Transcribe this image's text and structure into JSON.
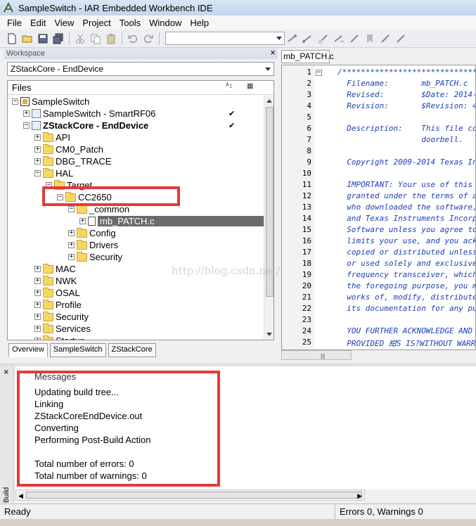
{
  "window": {
    "title": "SampleSwitch - IAR Embedded Workbench IDE"
  },
  "menu": [
    "File",
    "Edit",
    "View",
    "Project",
    "Tools",
    "Window",
    "Help"
  ],
  "workspace": {
    "header": "Workspace",
    "config": "ZStackCore - EndDevice",
    "files_header": "Files",
    "tree": [
      {
        "label": "SampleSwitch",
        "depth": 0,
        "kind": "workspace",
        "expander": "−"
      },
      {
        "label": "SampleSwitch - SmartRF06",
        "depth": 1,
        "kind": "project",
        "expander": "+",
        "check": "✔"
      },
      {
        "label": "ZStackCore - EndDevice",
        "depth": 1,
        "kind": "project",
        "expander": "−",
        "check": "✔",
        "bold": true
      },
      {
        "label": "API",
        "depth": 2,
        "kind": "folder",
        "expander": "+"
      },
      {
        "label": "CM0_Patch",
        "depth": 2,
        "kind": "folder",
        "expander": "+"
      },
      {
        "label": "DBG_TRACE",
        "depth": 2,
        "kind": "folder",
        "expander": "+"
      },
      {
        "label": "HAL",
        "depth": 2,
        "kind": "folder",
        "expander": "−"
      },
      {
        "label": "Target",
        "depth": 3,
        "kind": "folder",
        "expander": "−"
      },
      {
        "label": "CC2650",
        "depth": 4,
        "kind": "folder",
        "expander": "−"
      },
      {
        "label": "_common",
        "depth": 5,
        "kind": "folder",
        "expander": "−"
      },
      {
        "label": "mb_PATCH.c",
        "depth": 6,
        "kind": "file",
        "expander": "+",
        "selected": true
      },
      {
        "label": "Config",
        "depth": 5,
        "kind": "folder",
        "expander": "+"
      },
      {
        "label": "Drivers",
        "depth": 5,
        "kind": "folder",
        "expander": "+"
      },
      {
        "label": "Security",
        "depth": 5,
        "kind": "folder",
        "expander": "+"
      },
      {
        "label": "MAC",
        "depth": 2,
        "kind": "folder",
        "expander": "+"
      },
      {
        "label": "NWK",
        "depth": 2,
        "kind": "folder",
        "expander": "+"
      },
      {
        "label": "OSAL",
        "depth": 2,
        "kind": "folder",
        "expander": "+"
      },
      {
        "label": "Profile",
        "depth": 2,
        "kind": "folder",
        "expander": "+"
      },
      {
        "label": "Security",
        "depth": 2,
        "kind": "folder",
        "expander": "+"
      },
      {
        "label": "Services",
        "depth": 2,
        "kind": "folder",
        "expander": "+"
      },
      {
        "label": "Startup",
        "depth": 2,
        "kind": "folder",
        "expander": "+"
      }
    ],
    "tabs": [
      "Overview",
      "SampleSwitch",
      "ZStackCore"
    ]
  },
  "editor": {
    "tab": "mb_PATCH.c",
    "lines": [
      {
        "n": "1",
        "t": "/*********************************"
      },
      {
        "n": "2",
        "t": "  Filename:       mb_PATCH.c"
      },
      {
        "n": "3",
        "t": "  Revised:        $Date: 2014-"
      },
      {
        "n": "4",
        "t": "  Revision:       $Revision: 4"
      },
      {
        "n": "5",
        "t": ""
      },
      {
        "n": "6",
        "t": "  Description:    This file co"
      },
      {
        "n": "7",
        "t": "                  doorbell."
      },
      {
        "n": "8",
        "t": ""
      },
      {
        "n": "9",
        "t": "  Copyright 2009-2014 Texas In"
      },
      {
        "n": "10",
        "t": ""
      },
      {
        "n": "11",
        "t": "  IMPORTANT: Your use of this"
      },
      {
        "n": "12",
        "t": "  granted under the terms of a"
      },
      {
        "n": "13",
        "t": "  who downloaded the software,"
      },
      {
        "n": "14",
        "t": "  and Texas Instruments Incorp"
      },
      {
        "n": "15",
        "t": "  Software unless you agree to"
      },
      {
        "n": "16",
        "t": "  limits your use, and you ack"
      },
      {
        "n": "17",
        "t": "  copied or distributed unless"
      },
      {
        "n": "18",
        "t": "  or used solely and exclusive"
      },
      {
        "n": "19",
        "t": "  frequency transceiver, which"
      },
      {
        "n": "20",
        "t": "  the foregoing purpose, you m"
      },
      {
        "n": "21",
        "t": "  works of, modify, distribute"
      },
      {
        "n": "22",
        "t": "  its documentation for any pu"
      },
      {
        "n": "23",
        "t": ""
      },
      {
        "n": "24",
        "t": "  YOU FURTHER ACKNOWLEDGE AND"
      },
      {
        "n": "25",
        "t": "  PROVIDED 紺S IS?WITHOUT WARR"
      }
    ]
  },
  "messages": {
    "header": "Messages",
    "side_label": "Build",
    "lines": [
      "Updating build tree...",
      "Linking",
      "ZStackCoreEndDevice.out",
      "Converting",
      "Performing Post-Build Action",
      "",
      "Total number of errors: 0",
      "Total number of warnings: 0"
    ]
  },
  "status": {
    "ready": "Ready",
    "errors": "Errors 0, Warnings 0"
  },
  "watermark": "http://blog.csdn.net/",
  "colors": {
    "highlight_box": "#e53a3a",
    "selection": "#6b6b6b",
    "comment": "#1b40b8"
  }
}
